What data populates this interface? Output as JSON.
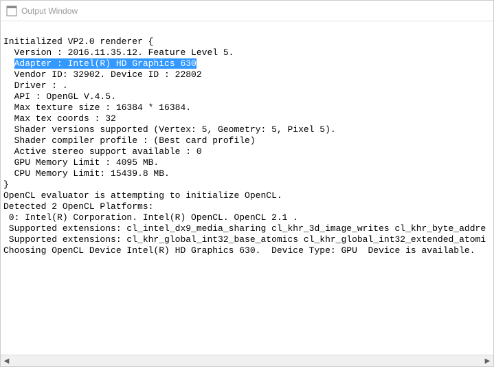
{
  "window": {
    "title": "Output Window"
  },
  "log": {
    "lines": [
      "",
      "Initialized VP2.0 renderer {",
      "  Version : 2016.11.35.12. Feature Level 5.",
      "  Adapter : Intel(R) HD Graphics 630",
      "  Vendor ID: 32902. Device ID : 22802",
      "  Driver : .",
      "  API : OpenGL V.4.5.",
      "  Max texture size : 16384 * 16384.",
      "  Max tex coords : 32",
      "  Shader versions supported (Vertex: 5, Geometry: 5, Pixel 5).",
      "  Shader compiler profile : (Best card profile)",
      "  Active stereo support available : 0",
      "  GPU Memory Limit : 4095 MB.",
      "  CPU Memory Limit: 15439.8 MB.",
      "}",
      "OpenCL evaluator is attempting to initialize OpenCL.",
      "Detected 2 OpenCL Platforms: ",
      " 0: Intel(R) Corporation. Intel(R) OpenCL. OpenCL 2.1 .",
      " Supported extensions: cl_intel_dx9_media_sharing cl_khr_3d_image_writes cl_khr_byte_addre",
      " Supported extensions: cl_khr_global_int32_base_atomics cl_khr_global_int32_extended_atomi",
      "Choosing OpenCL Device Intel(R) HD Graphics 630.  Device Type: GPU  Device is available."
    ],
    "selected_line_index": 3
  },
  "scrollbar": {
    "left_arrow": "◀",
    "right_arrow": "▶"
  }
}
